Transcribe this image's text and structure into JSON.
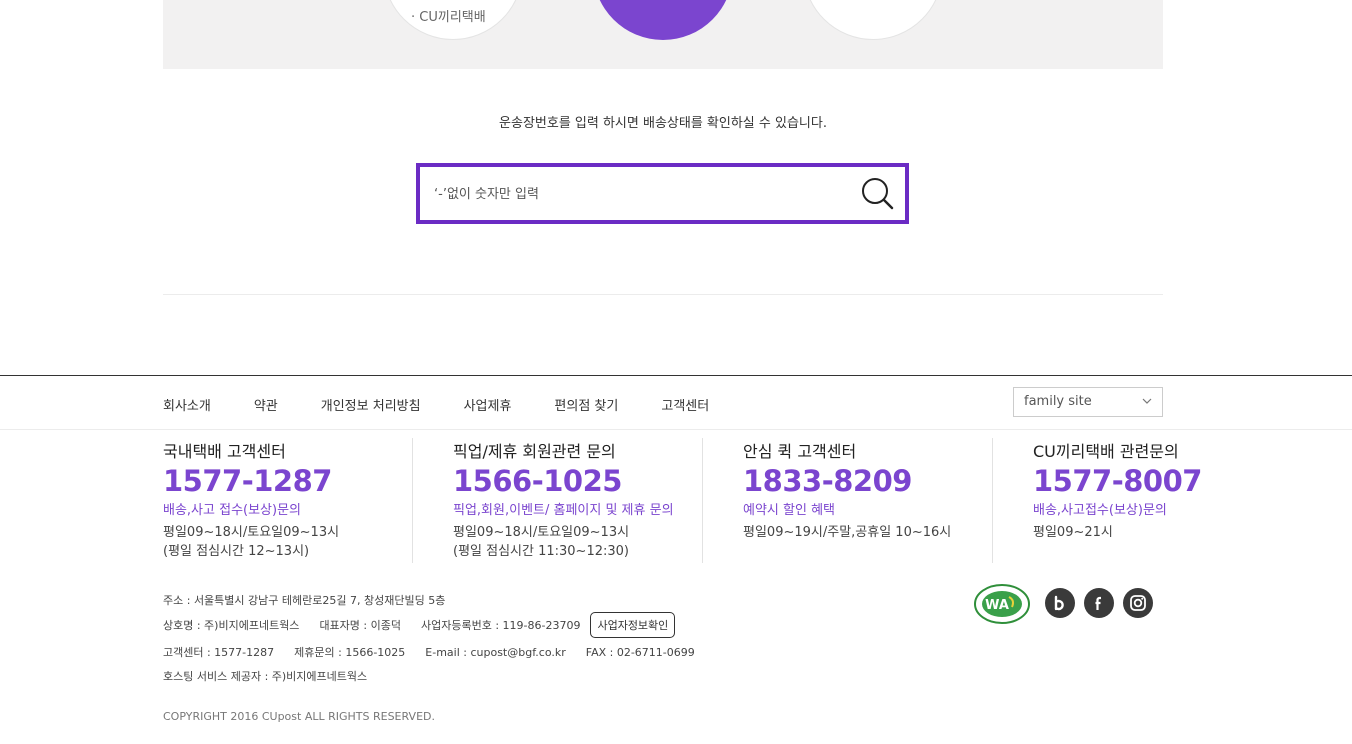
{
  "top_band": {
    "circle_label": "· CU끼리택배"
  },
  "tracking": {
    "description": "운송장번호를 입력 하시면 배송상태를 확인하실 수 있습니다.",
    "placeholder": "‘-’없이 숫자만 입력",
    "search_icon": "search-icon",
    "accent": "#6b2bc4"
  },
  "footer_nav": {
    "links": [
      "회사소개",
      "약관",
      "개인정보 처리방침",
      "사업제휴",
      "편의점 찾기",
      "고객센터"
    ],
    "family_site": "family site"
  },
  "customer_centers": [
    {
      "title": "국내택배 고객센터",
      "phone": "1577-1287",
      "sub": "배송,사고 접수(보상)문의",
      "hours1": "평일09~18시/토요일09~13시",
      "hours2": "(평일 점심시간 12~13시)"
    },
    {
      "title": "픽업/제휴 회원관련 문의",
      "phone": "1566-1025",
      "sub": "픽업,회원,이벤트/ 홈페이지 및 제휴 문의",
      "hours1": "평일09~18시/토요일09~13시",
      "hours2": "(평일 점심시간 11:30~12:30)"
    },
    {
      "title": "안심 퀵 고객센터",
      "phone": "1833-8209",
      "sub": "예약시 할인 혜택",
      "hours1": "평일09~19시/주말,공휴일 10~16시",
      "hours2": ""
    },
    {
      "title": "CU끼리택배 관련문의",
      "phone": "1577-8007",
      "sub": "배송,사고접수(보상)문의",
      "hours1": "평일09~21시",
      "hours2": ""
    }
  ],
  "company": {
    "address": "주소 : 서울특별시 강남구 테헤란로25길 7, 창성재단빌딩 5층",
    "name": "상호명 : 주)비지에프네트웍스",
    "ceo": "대표자명 : 이종덕",
    "biz_no": "사업자등록번호 : 119-86-23709",
    "biz_check_button": "사업자정보확인",
    "cs_phone": "고객센터 : 1577-1287",
    "partner_phone": "제휴문의 : 1566-1025",
    "email": "E-mail : cupost@bgf.co.kr",
    "fax": "FAX : 02-6711-0699",
    "hosting": "호스팅 서비스 제공자 : 주)비지에프네트웍스",
    "copyright": "COPYRIGHT 2016 CUpost ALL RIGHTS RESERVED."
  },
  "badges": {
    "wa_text": "WA",
    "sns": [
      "blog-icon",
      "facebook-icon",
      "instagram-icon"
    ]
  },
  "colors": {
    "brand_purple": "#7b45cf",
    "band_grey": "#f2f1f1"
  }
}
